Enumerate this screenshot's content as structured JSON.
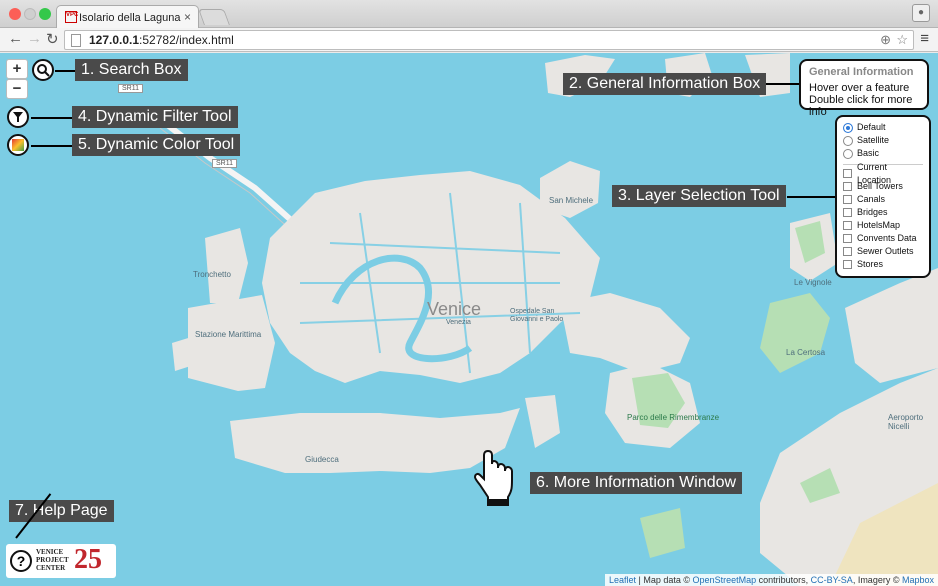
{
  "browser": {
    "tab_title": "Isolario della Laguna",
    "tab_favicon_text": "VPC",
    "tab_close": "×",
    "url_host": "127.0.0.1",
    "url_rest": ":52782/index.html"
  },
  "map": {
    "zoom_in": "+",
    "zoom_out": "−",
    "labels": {
      "venice": "Venice",
      "venezia": "Venezia",
      "san_michele": "San Michele",
      "ospedale": "Ospedale San Giovanni e Paolo",
      "tronchetto": "Tronchetto",
      "stazione": "Stazione Marittima",
      "giudecca": "Giudecca",
      "rimembranze": "Parco delle Rimembranze",
      "le_vignole": "Le Vignole",
      "la_certosa": "La Certosa",
      "aeroporto": "Aeroporto Nicelli",
      "road1": "SR11",
      "road2": "SR11"
    }
  },
  "callouts": {
    "search": "1. Search Box",
    "info": "2. General Information Box",
    "layers": "3. Layer Selection Tool",
    "filter": "4. Dynamic Filter Tool",
    "color": "5. Dynamic Color Tool",
    "more": "6. More Information Window",
    "help": "7. Help Page"
  },
  "info_box": {
    "heading": "General Information",
    "line1": "Hover over a feature",
    "line2": "Double click for more info"
  },
  "layers": {
    "base": [
      "Default",
      "Satellite",
      "Basic"
    ],
    "selected_base": "Default",
    "overlays": [
      "Current Location",
      "Bell Towers",
      "Canals",
      "Bridges",
      "HotelsMap",
      "Convents Data",
      "Sewer Outlets",
      "Stores"
    ]
  },
  "logo": {
    "help_glyph": "?",
    "line1": "VENICE",
    "line2": "PROJECT",
    "line3": "CENTER",
    "number": "25"
  },
  "attribution": {
    "leaflet": "Leaflet",
    "sep": " | Map data © ",
    "osm": "OpenStreetMap",
    "mid": " contributors, ",
    "license": "CC-BY-SA",
    "imagery": ", Imagery © ",
    "mapbox": "Mapbox"
  },
  "colors": {
    "water": "#7ccde4",
    "land": "#e8e6e3",
    "park": "#b6dfb4",
    "callout": "#4a4a4a",
    "radio_on": "#2f7ad8"
  }
}
